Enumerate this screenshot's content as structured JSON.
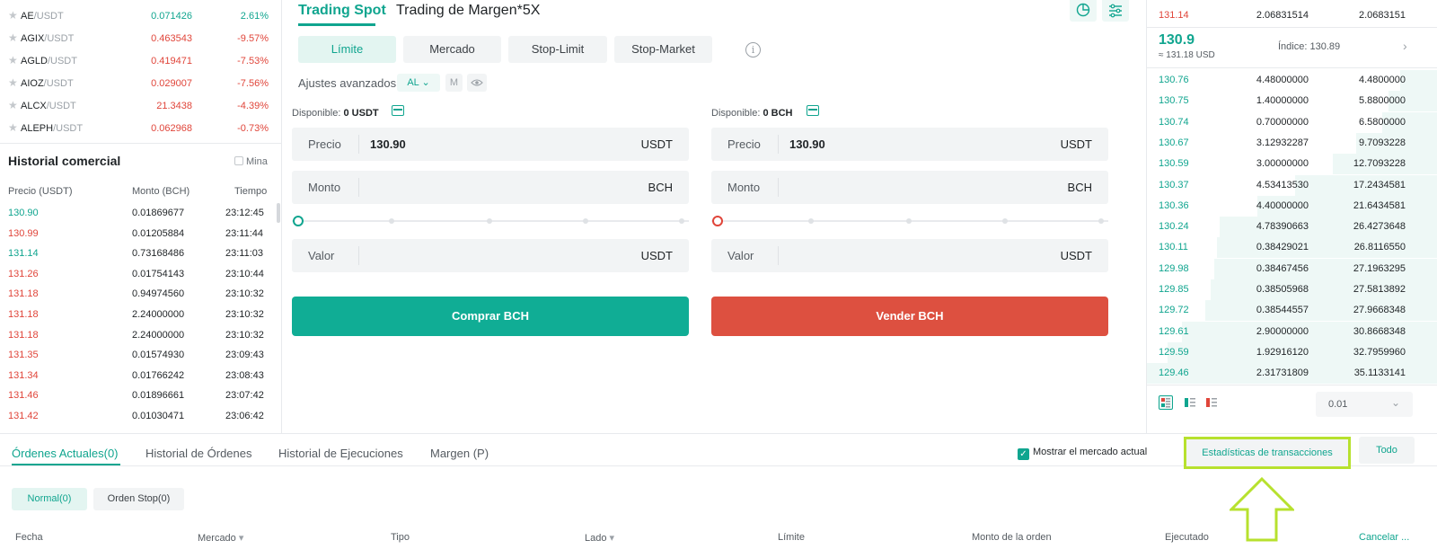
{
  "markets": [
    {
      "base": "AE",
      "quote": "/USDT",
      "price": "0.071426",
      "change": "2.61%",
      "dir": "up"
    },
    {
      "base": "AGIX",
      "quote": "/USDT",
      "price": "0.463543",
      "change": "-9.57%",
      "dir": "down"
    },
    {
      "base": "AGLD",
      "quote": "/USDT",
      "price": "0.419471",
      "change": "-7.53%",
      "dir": "down"
    },
    {
      "base": "AIOZ",
      "quote": "/USDT",
      "price": "0.029007",
      "change": "-7.56%",
      "dir": "down"
    },
    {
      "base": "ALCX",
      "quote": "/USDT",
      "price": "21.3438",
      "change": "-4.39%",
      "dir": "down"
    },
    {
      "base": "ALEPH",
      "quote": "/USDT",
      "price": "0.062968",
      "change": "-0.73%",
      "dir": "down"
    }
  ],
  "history": {
    "title": "Historial comercial",
    "mine_label": "Mina",
    "headers": {
      "price": "Precio (USDT)",
      "amount": "Monto (BCH)",
      "time": "Tiempo"
    },
    "rows": [
      {
        "price": "130.90",
        "amount": "0.01869677",
        "time": "23:12:45",
        "dir": "up"
      },
      {
        "price": "130.99",
        "amount": "0.01205884",
        "time": "23:11:44",
        "dir": "down"
      },
      {
        "price": "131.14",
        "amount": "0.73168486",
        "time": "23:11:03",
        "dir": "up"
      },
      {
        "price": "131.26",
        "amount": "0.01754143",
        "time": "23:10:44",
        "dir": "down"
      },
      {
        "price": "131.18",
        "amount": "0.94974560",
        "time": "23:10:32",
        "dir": "down"
      },
      {
        "price": "131.18",
        "amount": "2.24000000",
        "time": "23:10:32",
        "dir": "down"
      },
      {
        "price": "131.18",
        "amount": "2.24000000",
        "time": "23:10:32",
        "dir": "down"
      },
      {
        "price": "131.35",
        "amount": "0.01574930",
        "time": "23:09:43",
        "dir": "down"
      },
      {
        "price": "131.34",
        "amount": "0.01766242",
        "time": "23:08:43",
        "dir": "down"
      },
      {
        "price": "131.46",
        "amount": "0.01896661",
        "time": "23:07:42",
        "dir": "down"
      },
      {
        "price": "131.42",
        "amount": "0.01030471",
        "time": "23:06:42",
        "dir": "down"
      }
    ]
  },
  "trade": {
    "tab_spot": "Trading Spot",
    "tab_margin": "Trading de Margen*5X",
    "order_types": [
      "Límite",
      "Mercado",
      "Stop-Limit",
      "Stop-Market"
    ],
    "info_glyph": "i",
    "adv_label": "Ajustes avanzados:",
    "adv_chip_al": "AL",
    "adv_chip_m": "M",
    "buy": {
      "avail_label": "Disponible:",
      "avail_value": "0 USDT",
      "price_label": "Precio",
      "price_value": "130.90",
      "price_unit": "USDT",
      "amount_label": "Monto",
      "amount_unit": "BCH",
      "value_label": "Valor",
      "value_unit": "USDT",
      "button": "Comprar BCH"
    },
    "sell": {
      "avail_label": "Disponible:",
      "avail_value": "0 BCH",
      "price_label": "Precio",
      "price_value": "130.90",
      "price_unit": "USDT",
      "amount_label": "Monto",
      "amount_unit": "BCH",
      "value_label": "Valor",
      "value_unit": "USDT",
      "button": "Vender BCH"
    }
  },
  "book": {
    "top_row": {
      "price": "131.14",
      "amount": "2.06831514",
      "total": "2.0683151"
    },
    "last_price": "130.9",
    "last_usd": "≈ 131.18 USD",
    "index_label": "Índice: 130.89",
    "bids": [
      {
        "price": "130.76",
        "amount": "4.48000000",
        "total": "4.4800000",
        "depth": 0.13
      },
      {
        "price": "130.75",
        "amount": "1.40000000",
        "total": "5.8800000",
        "depth": 0.17
      },
      {
        "price": "130.74",
        "amount": "0.70000000",
        "total": "6.5800000",
        "depth": 0.19
      },
      {
        "price": "130.67",
        "amount": "3.12932287",
        "total": "9.7093228",
        "depth": 0.28
      },
      {
        "price": "130.59",
        "amount": "3.00000000",
        "total": "12.7093228",
        "depth": 0.36
      },
      {
        "price": "130.37",
        "amount": "4.53413530",
        "total": "17.2434581",
        "depth": 0.49
      },
      {
        "price": "130.36",
        "amount": "4.40000000",
        "total": "21.6434581",
        "depth": 0.62
      },
      {
        "price": "130.24",
        "amount": "4.78390663",
        "total": "26.4273648",
        "depth": 0.75
      },
      {
        "price": "130.11",
        "amount": "0.38429021",
        "total": "26.8116550",
        "depth": 0.76
      },
      {
        "price": "129.98",
        "amount": "0.38467456",
        "total": "27.1963295",
        "depth": 0.77
      },
      {
        "price": "129.85",
        "amount": "0.38505968",
        "total": "27.5813892",
        "depth": 0.78
      },
      {
        "price": "129.72",
        "amount": "0.38544557",
        "total": "27.9668348",
        "depth": 0.8
      },
      {
        "price": "129.61",
        "amount": "2.90000000",
        "total": "30.8668348",
        "depth": 0.88
      },
      {
        "price": "129.59",
        "amount": "1.92916120",
        "total": "32.7959960",
        "depth": 0.93
      },
      {
        "price": "129.46",
        "amount": "2.31731809",
        "total": "35.1133141",
        "depth": 1.0
      }
    ],
    "precision": "0.01"
  },
  "bottom": {
    "tabs": [
      "Órdenes Actuales(0)",
      "Historial de Órdenes",
      "Historial de Ejecuciones",
      "Margen (P)"
    ],
    "show_market": "Mostrar el mercado actual",
    "stats_button": "Estadísticas de transacciones",
    "all_button": "Todo",
    "subtabs": [
      "Normal(0)",
      "Orden Stop(0)"
    ],
    "columns": [
      "Fecha",
      "Mercado",
      "Tipo",
      "Lado",
      "Límite",
      "Monto de la orden",
      "Ejecutado",
      "Cancelar ..."
    ]
  },
  "colors": {
    "green": "#10a58f",
    "red": "#e0453a",
    "highlight": "#b7e12e"
  }
}
